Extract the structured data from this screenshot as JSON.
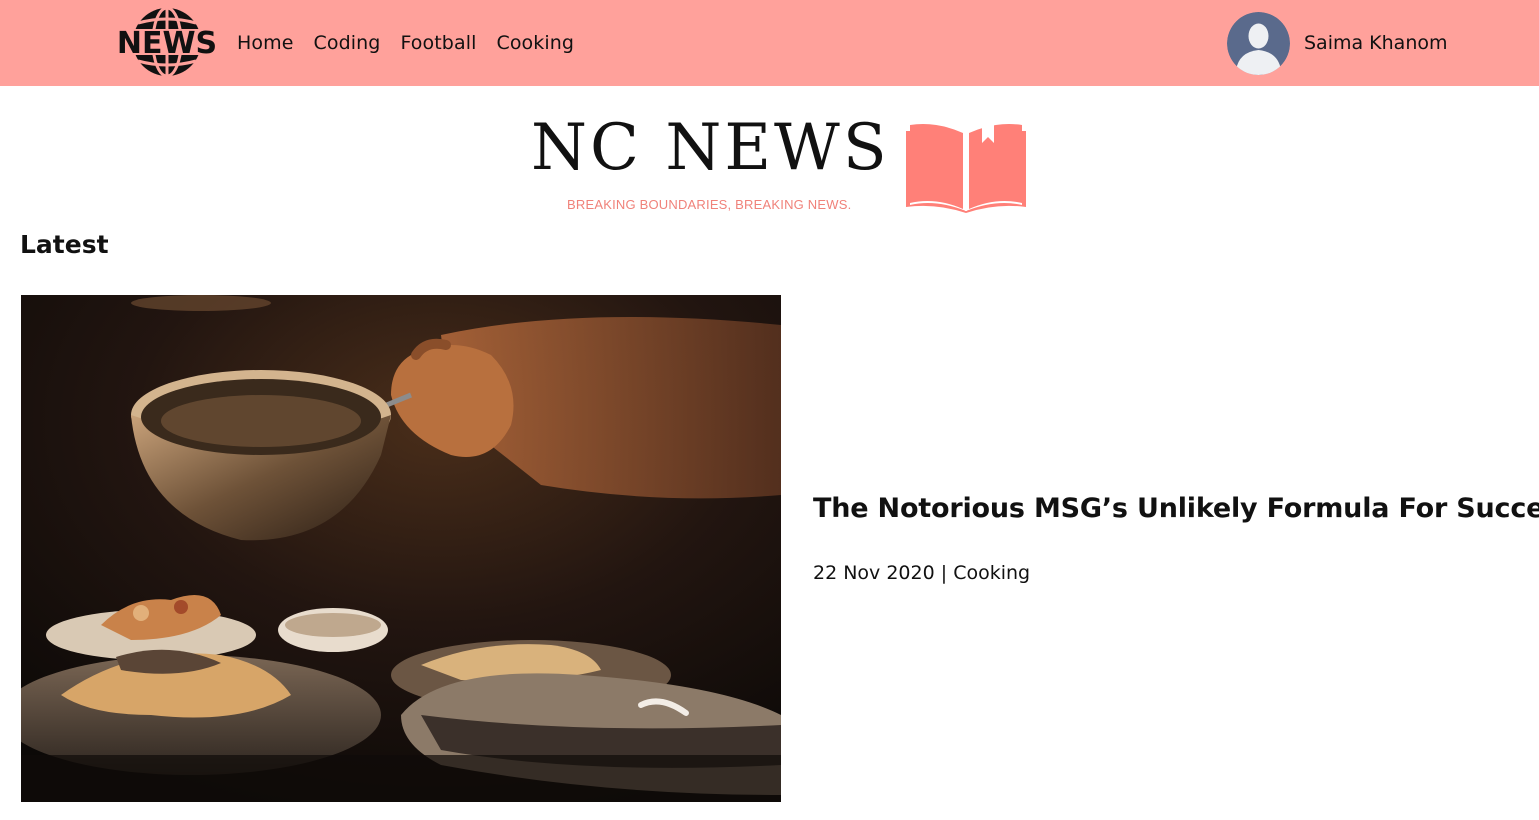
{
  "header": {
    "logo_text": "NEWS",
    "nav_items": [
      {
        "label": "Home"
      },
      {
        "label": "Coding"
      },
      {
        "label": "Football"
      },
      {
        "label": "Cooking"
      }
    ],
    "user": {
      "name": "Saima Khanom",
      "avatar_icon": "default-user-avatar-icon"
    }
  },
  "masthead": {
    "title": "NC NEWS",
    "tagline": "BREAKING BOUNDARIES, BREAKING NEWS.",
    "icon": "open-book-icon"
  },
  "colors": {
    "header_bg": "#ffa19b",
    "accent": "#ff8078",
    "tagline": "#f0827a",
    "avatar_bg": "#5a6a8c"
  },
  "latest": {
    "heading": "Latest",
    "article": {
      "title": "The Notorious MSG’s Unlikely Formula For Success",
      "date": "22 Nov 2020",
      "separator": "|",
      "topic": "Cooking"
    }
  }
}
